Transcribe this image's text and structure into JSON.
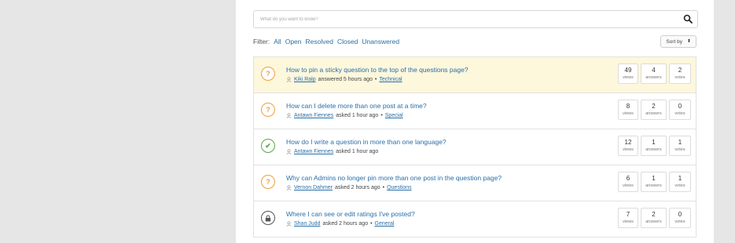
{
  "search": {
    "placeholder": "What do you want to know?",
    "icon": "search-icon"
  },
  "filter": {
    "label": "Filter:",
    "options": [
      "All",
      "Open",
      "Resolved",
      "Closed",
      "Unanswered"
    ]
  },
  "sort": {
    "label": "Sort by",
    "arrows": "⬍"
  },
  "colors": {
    "link": "#2a6fa8",
    "open": "#f0a03c",
    "resolved": "#5aa84a",
    "highlight": "#fdf7dc"
  },
  "questions": [
    {
      "title": "How to pin a sticky question to the top of the questions page?",
      "user": "Kiki Ralp",
      "action": "answered 5 hours ago",
      "sep": "•",
      "category": "Technical",
      "status": "open",
      "status_glyph": "?",
      "views": "49",
      "answers": "4",
      "votes": "2",
      "views_label": "views",
      "answers_label": "answers",
      "votes_label": "votes"
    },
    {
      "title": "How can I delete more than one post at a time?",
      "user": "Antawn Fiennes",
      "action": "asked 1 hour ago",
      "sep": "•",
      "category": "Special",
      "status": "open",
      "status_glyph": "?",
      "views": "8",
      "answers": "2",
      "votes": "0",
      "views_label": "views",
      "answers_label": "answers",
      "votes_label": "votes"
    },
    {
      "title": "How do I write a question in more than one language?",
      "user": "Antawn Fiennes",
      "action": "asked 1 hour ago",
      "sep": "",
      "category": "",
      "status": "resolved",
      "status_glyph": "✔",
      "views": "12",
      "answers": "1",
      "votes": "1",
      "views_label": "views",
      "answers_label": "answers",
      "votes_label": "votes"
    },
    {
      "title": "Why can Admins no longer pin more than one post in the question page?",
      "user": "Vernon Dahmer",
      "action": "asked 2 hours ago",
      "sep": "•",
      "category": "Questions",
      "status": "open",
      "status_glyph": "?",
      "views": "6",
      "answers": "1",
      "votes": "1",
      "views_label": "views",
      "answers_label": "answers",
      "votes_label": "votes"
    },
    {
      "title": "Where I can see or edit ratings I've posted?",
      "user": "Shan Judd",
      "action": "asked 2 hours ago",
      "sep": "•",
      "category": "General",
      "status": "locked",
      "status_glyph": "",
      "views": "7",
      "answers": "2",
      "votes": "0",
      "views_label": "views",
      "answers_label": "answers",
      "votes_label": "votes"
    }
  ]
}
